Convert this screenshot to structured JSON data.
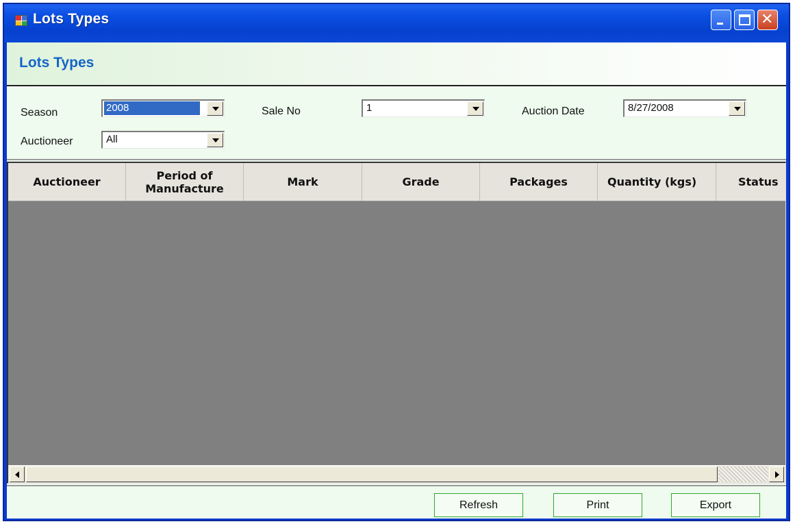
{
  "window": {
    "title": "Lots Types",
    "app_icon": "form-app-icon",
    "minimize_icon": "minimize-icon",
    "maximize_icon": "maximize-icon",
    "close_icon": "close-icon"
  },
  "header": {
    "title": "Lots Types"
  },
  "filters": {
    "season_label": "Season",
    "season_value": "2008",
    "sale_no_label": "Sale No",
    "sale_no_value": "1",
    "auction_date_label": "Auction Date",
    "auction_date_value": "8/27/2008",
    "auctioneer_label": "Auctioneer",
    "auctioneer_value": "All"
  },
  "grid": {
    "columns": [
      {
        "label": "Auctioneer"
      },
      {
        "label": "Period of Manufacture"
      },
      {
        "label": "Mark"
      },
      {
        "label": "Grade"
      },
      {
        "label": "Packages"
      },
      {
        "label": "Quantity (kgs)"
      },
      {
        "label": "Status"
      }
    ],
    "rows": []
  },
  "footer": {
    "refresh_label": "Refresh",
    "print_label": "Print",
    "export_label": "Export"
  },
  "colors": {
    "titlebar": "#0b47d6",
    "header_title": "#1565c8",
    "panel_bg": "#eefbee",
    "grid_bg": "#808080",
    "button_border": "#2fa82f"
  }
}
